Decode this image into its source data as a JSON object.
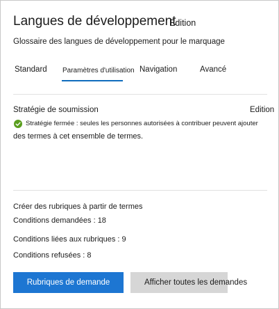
{
  "header": {
    "title": "Langues de développement",
    "edit_label": "Edition",
    "subtitle": "Glossaire des langues de développement pour le marquage"
  },
  "tabs": [
    {
      "label": "Standard",
      "active": false
    },
    {
      "label": "Paramètres d'utilisation",
      "active": true
    },
    {
      "label": "Navigation",
      "active": false
    },
    {
      "label": "Avancé",
      "active": false
    }
  ],
  "submission": {
    "title": "Stratégie de soumission",
    "edit_label": "Edition",
    "policy_line1": "Stratégie fermée : seules les personnes autorisées à contribuer peuvent ajouter",
    "policy_line2": "des termes à cet ensemble de termes.",
    "status_color": "#5a9e1e"
  },
  "stats": {
    "heading": "Créer des rubriques à partir de termes",
    "requested": "Conditions demandées : 18",
    "linked": "Conditions liées aux rubriques : 9",
    "refused": "Conditions refusées : 8"
  },
  "buttons": {
    "primary_label": "Rubriques de demande",
    "secondary_label": "Afficher toutes les demandes",
    "primary_color": "#1d76d2"
  }
}
